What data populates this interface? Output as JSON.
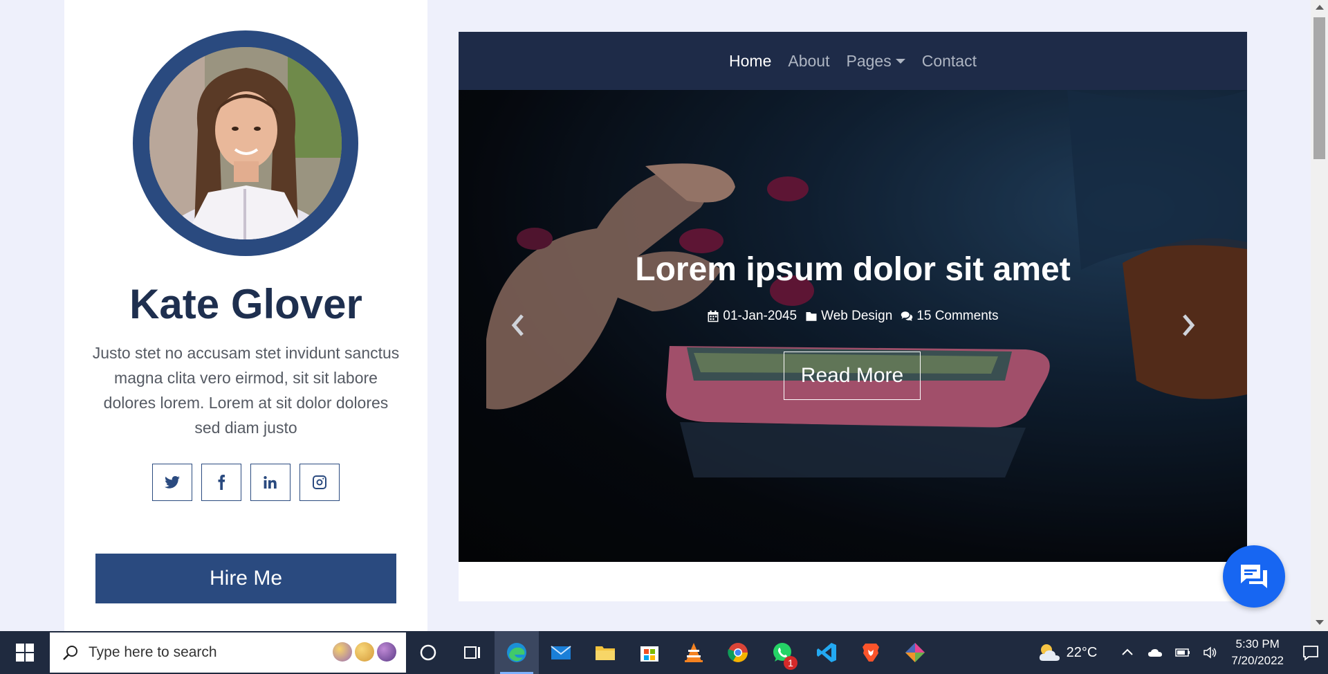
{
  "profile": {
    "name": "Kate Glover",
    "bio": "Justo stet no accusam stet invidunt sanctus magna clita vero eirmod, sit sit labore dolores lorem. Lorem at sit dolor dolores sed diam justo",
    "socials": [
      "twitter-icon",
      "facebook-icon",
      "linkedin-icon",
      "instagram-icon"
    ],
    "hire_label": "Hire Me"
  },
  "nav": {
    "items": [
      {
        "label": "Home",
        "active": true
      },
      {
        "label": "About"
      },
      {
        "label": "Pages",
        "dropdown": true
      },
      {
        "label": "Contact"
      }
    ]
  },
  "hero": {
    "title": "Lorem ipsum dolor sit amet",
    "date": "01-Jan-2045",
    "category": "Web Design",
    "comments": "15 Comments",
    "button_label": "Read More"
  },
  "taskbar": {
    "search_placeholder": "Type here to search",
    "apps": [
      "task-view",
      "edge",
      "mail",
      "file-explorer",
      "microsoft-store",
      "vlc",
      "chrome",
      "whatsapp",
      "vscode",
      "brave",
      "git-gui"
    ],
    "whatsapp_badge": "1",
    "temperature": "22°C",
    "time": "5:30 PM",
    "date": "7/20/2022"
  },
  "colors": {
    "accent": "#2a4a7f",
    "navbar": "#1e2b48",
    "page_bg": "#eef0fb",
    "chat_fab": "#1766f2"
  }
}
